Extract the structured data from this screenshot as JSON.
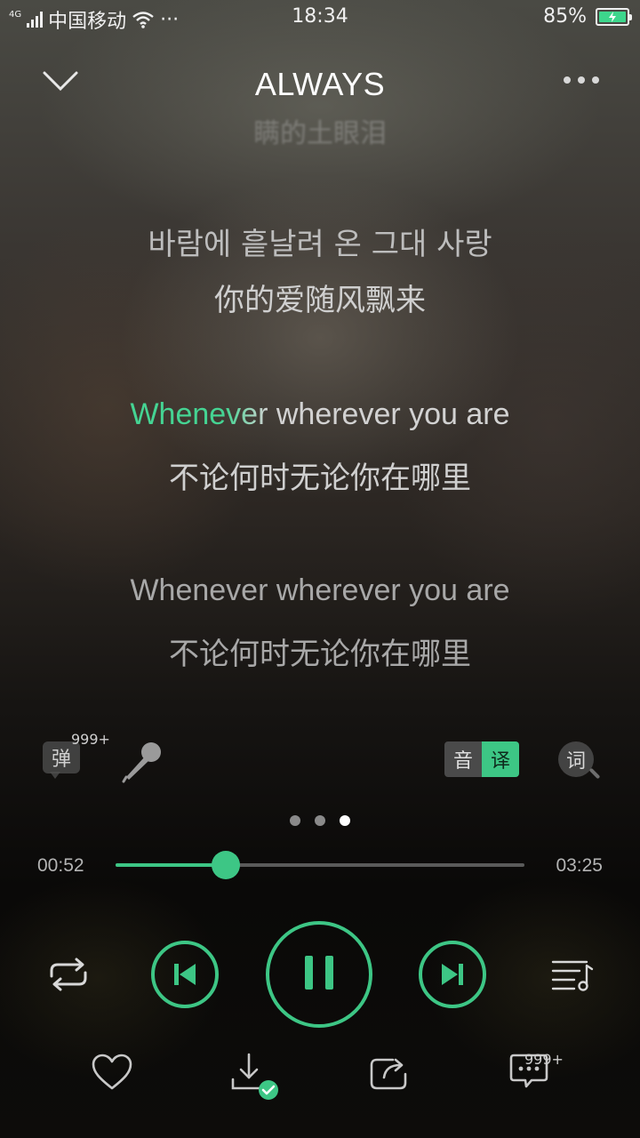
{
  "status_bar": {
    "network": "4G",
    "carrier": "中国移动",
    "overflow": "···",
    "time": "18:34",
    "battery": "85%"
  },
  "header": {
    "title": "ALWAYS",
    "icons": {
      "collapse": "chevron-down-icon",
      "more": "more-dots-icon"
    }
  },
  "lyrics": {
    "faded_top": "瞒的土眼泪",
    "korean": "바람에 흩날려 온 그대 사랑",
    "korean_translation": "你的爱随风飘来",
    "current_line": {
      "sung": "Whene",
      "partial": "ver",
      "rest": " wherever you are"
    },
    "current_translation": "不论何时无论你在哪里",
    "next_line": "Whenever wherever you are",
    "next_translation": "不论何时无论你在哪里"
  },
  "tools": {
    "danmu_label": "弹",
    "danmu_count": "999+",
    "pronounce_label": "音",
    "translate_label": "译",
    "lyric_search_label": "词",
    "icons": {
      "mic": "microphone-icon",
      "lyric_search": "search-icon"
    }
  },
  "pager": {
    "count": 3,
    "active_index": 2
  },
  "progress": {
    "current": "00:52",
    "total": "03:25",
    "fraction": 0.27
  },
  "controls": {
    "icons": {
      "loop": "repeat-icon",
      "prev": "skip-previous-icon",
      "play_pause": "pause-icon",
      "next": "skip-next-icon",
      "playlist": "playlist-icon"
    }
  },
  "actions": {
    "comment_count": "999+",
    "icons": {
      "like": "heart-icon",
      "download": "download-done-icon",
      "share": "share-icon",
      "comment": "comment-icon"
    }
  },
  "colors": {
    "accent": "#3dc685",
    "lyric_highlight": "#45d493"
  }
}
